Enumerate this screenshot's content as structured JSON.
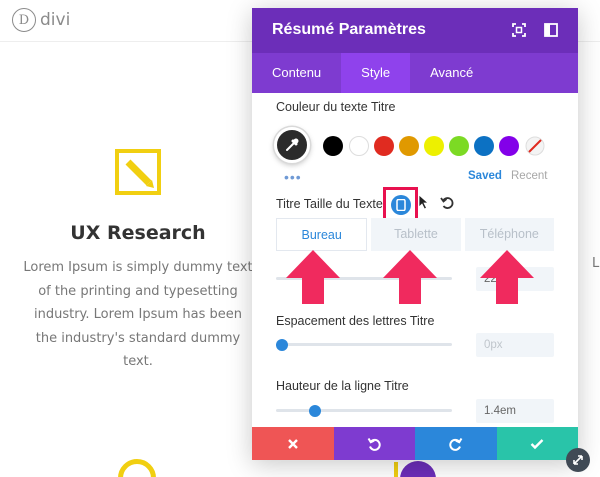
{
  "page": {
    "logo": {
      "letter": "D",
      "text": "divi"
    },
    "card": {
      "title": "UX Research",
      "text": "Lorem Ipsum is simply dummy text of the printing and typesetting industry. Lorem Ipsum has been the industry's standard dummy text."
    },
    "peek_text": "L"
  },
  "modal": {
    "title": "Résumé Paramètres",
    "tabs": [
      {
        "label": "Contenu",
        "active": false
      },
      {
        "label": "Style",
        "active": true
      },
      {
        "label": "Avancé",
        "active": false
      }
    ],
    "text_color": {
      "label": "Couleur du texte Titre",
      "swatches": [
        "#000000",
        "#ffffff",
        "#e02b20",
        "#e09900",
        "#edf000",
        "#7cda24",
        "#0c71c3",
        "#8300e9"
      ],
      "saved_label": "Saved",
      "recent_label": "Recent"
    },
    "font_size": {
      "label": "Titre Taille du Texte",
      "devices": [
        {
          "label": "Bureau",
          "active": true
        },
        {
          "label": "Tablette",
          "active": false
        },
        {
          "label": "Téléphone",
          "active": false
        }
      ],
      "value": "22",
      "slider_fraction": 0.2
    },
    "letter_spacing": {
      "label": "Espacement des lettres Titre",
      "placeholder": "0px",
      "slider_fraction": 0.0
    },
    "line_height": {
      "label": "Hauteur de la ligne Titre",
      "value": "1.4em",
      "slider_fraction": 0.2
    }
  },
  "colors": {
    "accent_purple": "#6c2eb9",
    "tab_bar_purple": "#7e3bd0",
    "active_tab_purple": "#8f42ec",
    "cancel_red": "#ef5555",
    "undo_purple": "#7e3bd0",
    "redo_blue": "#2b87da",
    "save_green": "#29c4a9",
    "highlight_pink": "#e8114f",
    "link_blue": "#2b87da"
  }
}
